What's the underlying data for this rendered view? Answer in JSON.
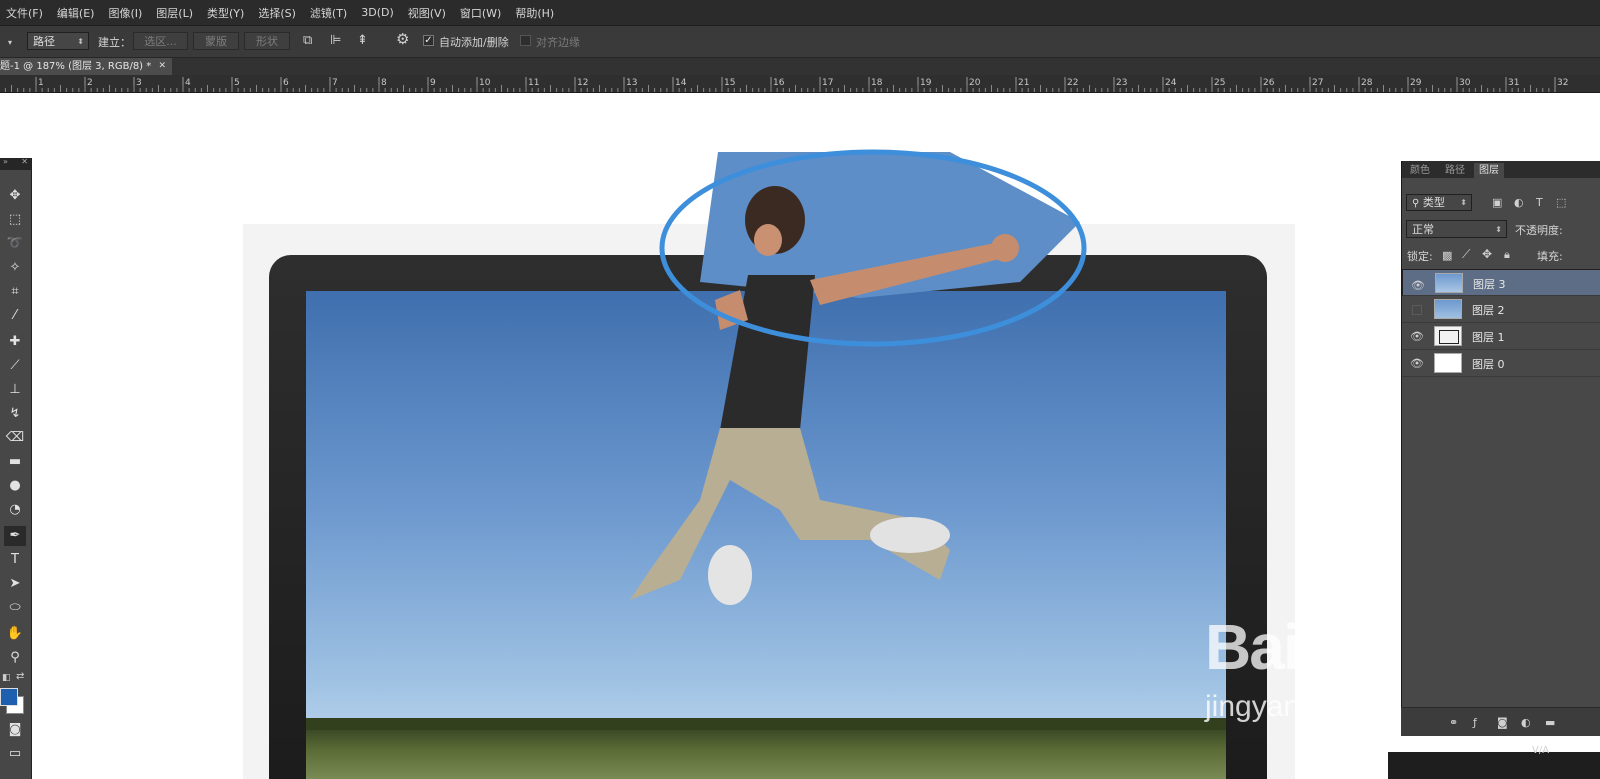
{
  "menu": [
    "文件(F)",
    "编辑(E)",
    "图像(I)",
    "图层(L)",
    "类型(Y)",
    "选择(S)",
    "滤镜(T)",
    "3D(D)",
    "视图(V)",
    "窗口(W)",
    "帮助(H)"
  ],
  "options": {
    "mode_value": "路径",
    "make_label": "建立：",
    "selection_button": "选区...",
    "mask_button": "蒙版",
    "shape_button": "形状",
    "auto_add_label": "自动添加/删除",
    "auto_add_checked": true,
    "align_edges_label": "对齐边缘",
    "align_edges_checked": false
  },
  "document": {
    "tab_title": "题-1 @ 187% (图层 3, RGB/8) *"
  },
  "ruler": [
    "1",
    "2",
    "3",
    "4",
    "5",
    "6",
    "7",
    "8",
    "9",
    "10",
    "11",
    "12",
    "13",
    "14",
    "15",
    "16",
    "17",
    "18",
    "19",
    "20",
    "21",
    "22",
    "23",
    "24",
    "25",
    "26",
    "27",
    "28",
    "29",
    "30",
    "31",
    "32"
  ],
  "tools": [
    "move-tool",
    "marquee-tool",
    "lasso-tool",
    "magic-wand-tool",
    "crop-tool",
    "eyedropper-tool",
    "healing-tool",
    "brush-tool",
    "stamp-tool",
    "history-brush-tool",
    "eraser-tool",
    "gradient-tool",
    "blur-tool",
    "dodge-tool",
    "pen-tool",
    "type-tool",
    "path-select-tool",
    "ellipse-tool",
    "hand-tool",
    "zoom-tool"
  ],
  "colors": {
    "foreground": "#1f5fb0",
    "background": "#ffffff",
    "highlight_ellipse": "#3d8fdc"
  },
  "layers_panel": {
    "tabs": [
      "颜色",
      "路径",
      "图层"
    ],
    "active_tab": "图层",
    "filter_label": "类型",
    "blend_mode": "正常",
    "opacity_label": "不透明度:",
    "lock_label": "锁定:",
    "fill_label": "填充:",
    "layers": [
      {
        "name": "图层 3",
        "visible": true,
        "selected": true
      },
      {
        "name": "图层 2",
        "visible": false,
        "selected": false
      },
      {
        "name": "图层 1",
        "visible": true,
        "selected": false
      },
      {
        "name": "图层 0",
        "visible": true,
        "selected": false
      }
    ]
  },
  "watermark": {
    "brand": "Bai 经验",
    "url": "jingyan.baidu.com"
  }
}
